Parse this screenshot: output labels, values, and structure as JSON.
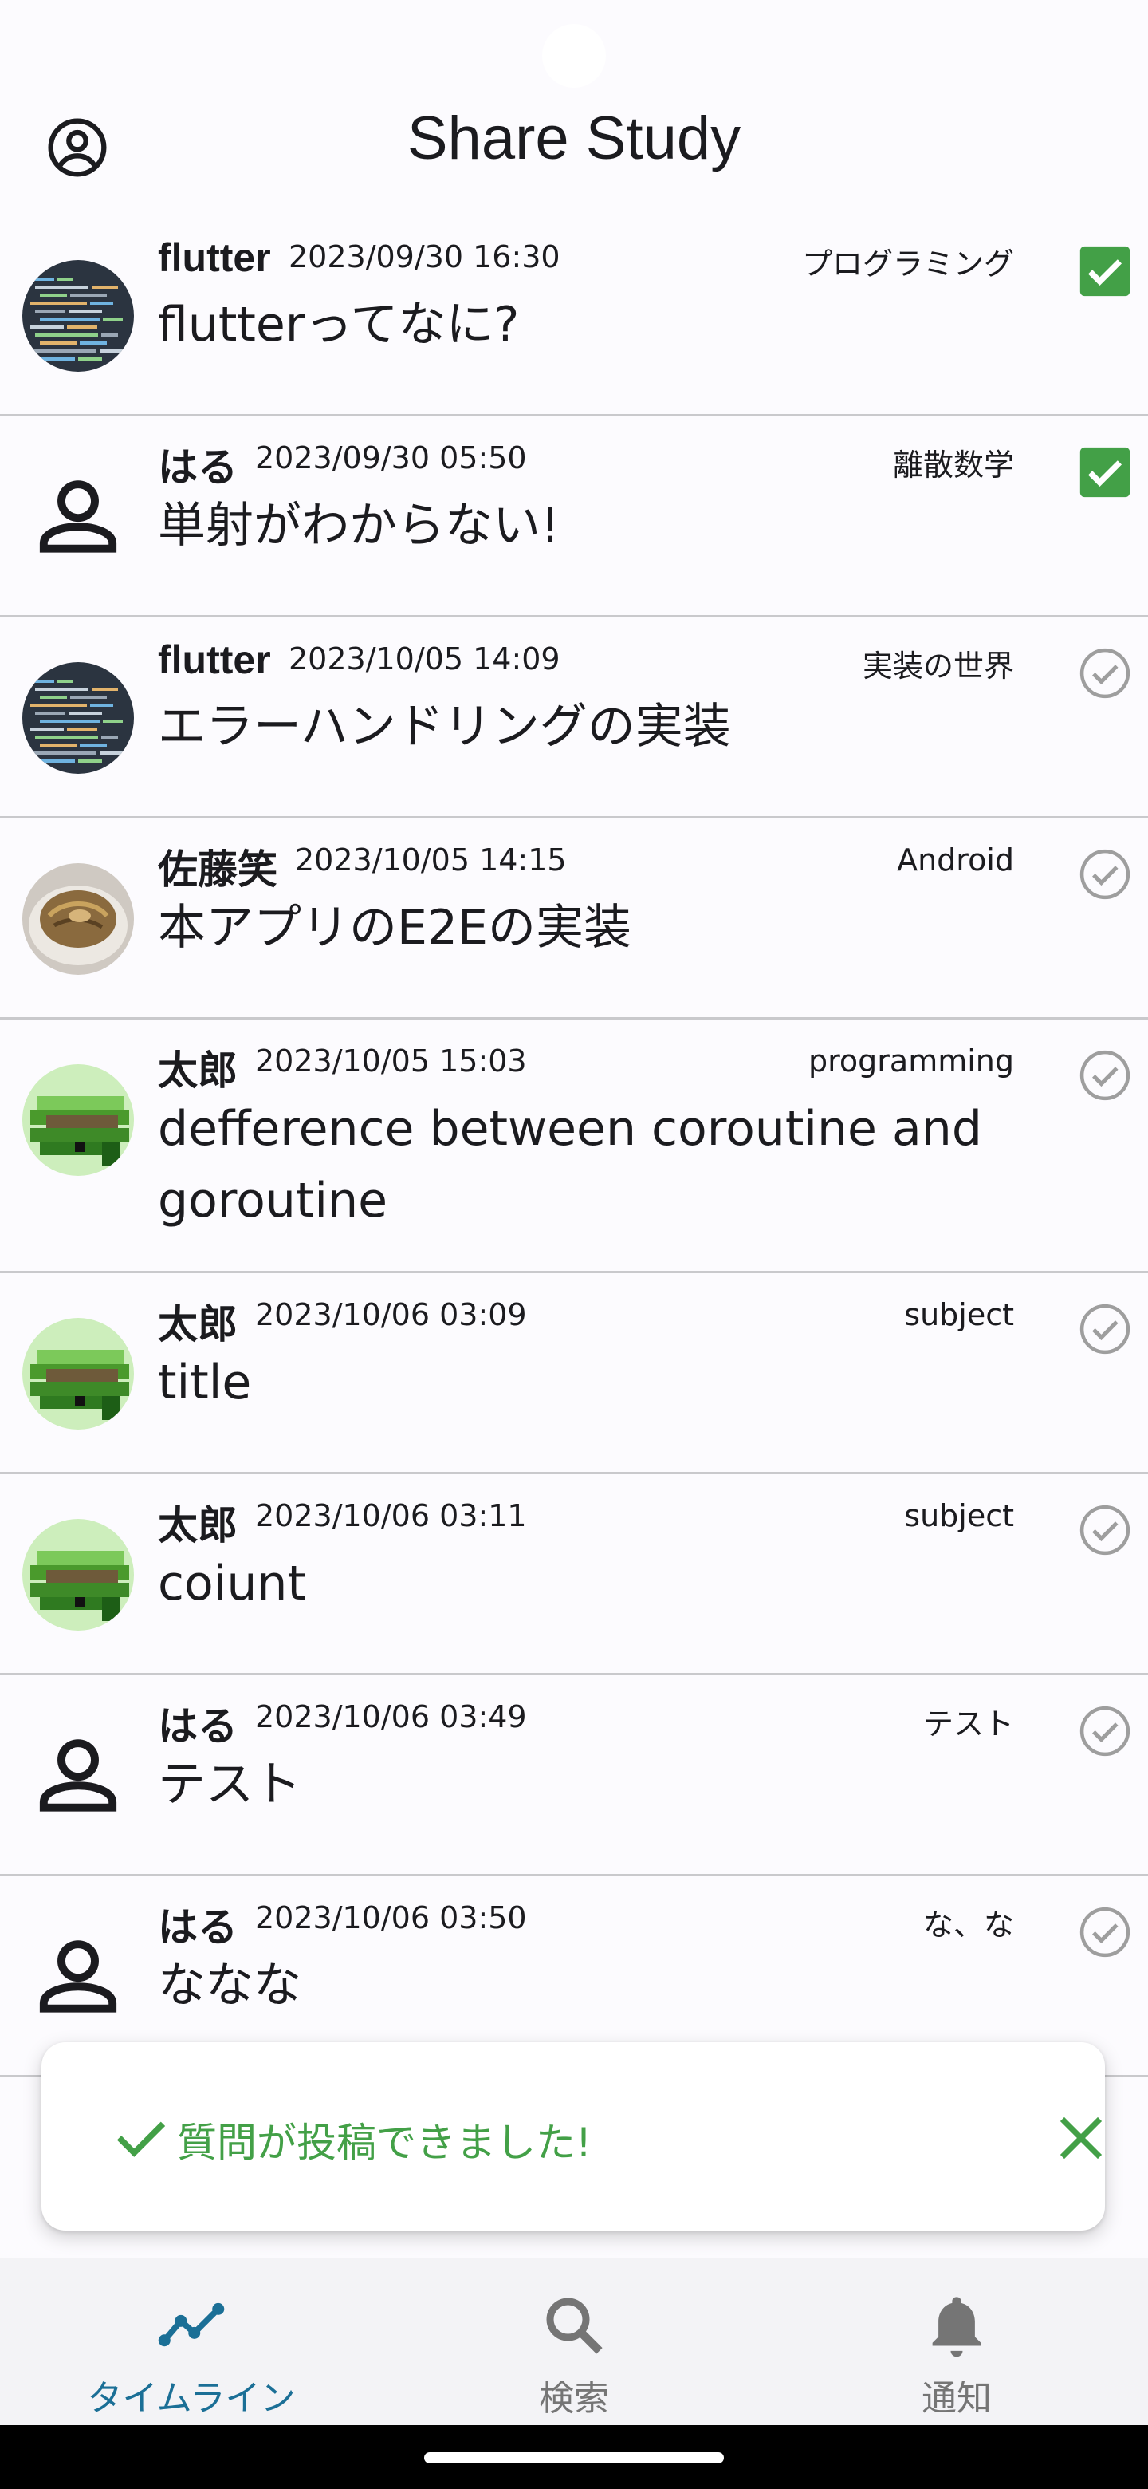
{
  "app": {
    "title": "Share Study"
  },
  "posts": [
    {
      "user": "flutter",
      "date": "2023/09/30 16:30",
      "subject": "プログラミング",
      "title": "flutterってなに?",
      "avatar": "code-screenshot",
      "resolved": true
    },
    {
      "user": "はる",
      "date": "2023/09/30 05:50",
      "subject": "離散数学",
      "title": "単射がわからない!",
      "avatar": "default-person",
      "resolved": true
    },
    {
      "user": "flutter",
      "date": "2023/10/05 14:09",
      "subject": "実装の世界",
      "title": "エラーハンドリングの実装",
      "avatar": "code-screenshot",
      "resolved": false
    },
    {
      "user": "佐藤笑",
      "date": "2023/10/05 14:15",
      "subject": "Android",
      "title": "本アプリのE2Eの実装",
      "avatar": "food-photo",
      "resolved": false
    },
    {
      "user": "太郎",
      "date": "2023/10/05 15:03",
      "subject": "programming",
      "title": "defference between coroutine and goroutine",
      "avatar": "pixel-art",
      "resolved": false
    },
    {
      "user": "太郎",
      "date": "2023/10/06 03:09",
      "subject": "subject",
      "title": "title",
      "avatar": "pixel-art",
      "resolved": false
    },
    {
      "user": "太郎",
      "date": "2023/10/06 03:11",
      "subject": "subject",
      "title": "coiunt",
      "avatar": "pixel-art",
      "resolved": false
    },
    {
      "user": "はる",
      "date": "2023/10/06 03:49",
      "subject": "テスト",
      "title": "テスト",
      "avatar": "default-person",
      "resolved": false
    },
    {
      "user": "はる",
      "date": "2023/10/06 03:50",
      "subject": "な、な",
      "title": "ななな",
      "avatar": "default-person",
      "resolved": false
    }
  ],
  "snackbar": {
    "message": "質問が投稿できました!",
    "icon": "check-icon",
    "close_icon": "close-icon"
  },
  "nav": {
    "items": [
      {
        "label": "タイムライン",
        "icon": "timeline-icon",
        "active": true
      },
      {
        "label": "検索",
        "icon": "search-icon",
        "active": false
      },
      {
        "label": "通知",
        "icon": "bell-icon",
        "active": false
      }
    ]
  },
  "colors": {
    "accent": "#1b6f96",
    "success": "#43a047",
    "inactive": "#757575",
    "divider": "#c9c9cc",
    "background": "#fcfbfe"
  }
}
